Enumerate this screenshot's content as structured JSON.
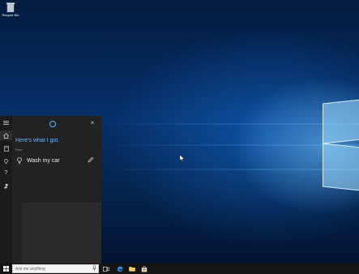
{
  "desktop": {
    "recycle_bin_label": "Recycle Bin"
  },
  "cortana": {
    "heading": "Here's what I got.",
    "section_label": "Rem",
    "reminder_text": "Wash my car",
    "accent_color": "#5fb2ff",
    "rail_icons": [
      "hamburger-icon",
      "home-icon",
      "notebook-icon",
      "lightbulb-icon",
      "question-icon",
      "feedback-icon"
    ]
  },
  "taskbar": {
    "search_placeholder": "Ask me anything",
    "icons": [
      "windows-start-icon",
      "microphone-icon",
      "task-view-icon",
      "edge-icon",
      "file-explorer-icon",
      "store-icon"
    ]
  }
}
